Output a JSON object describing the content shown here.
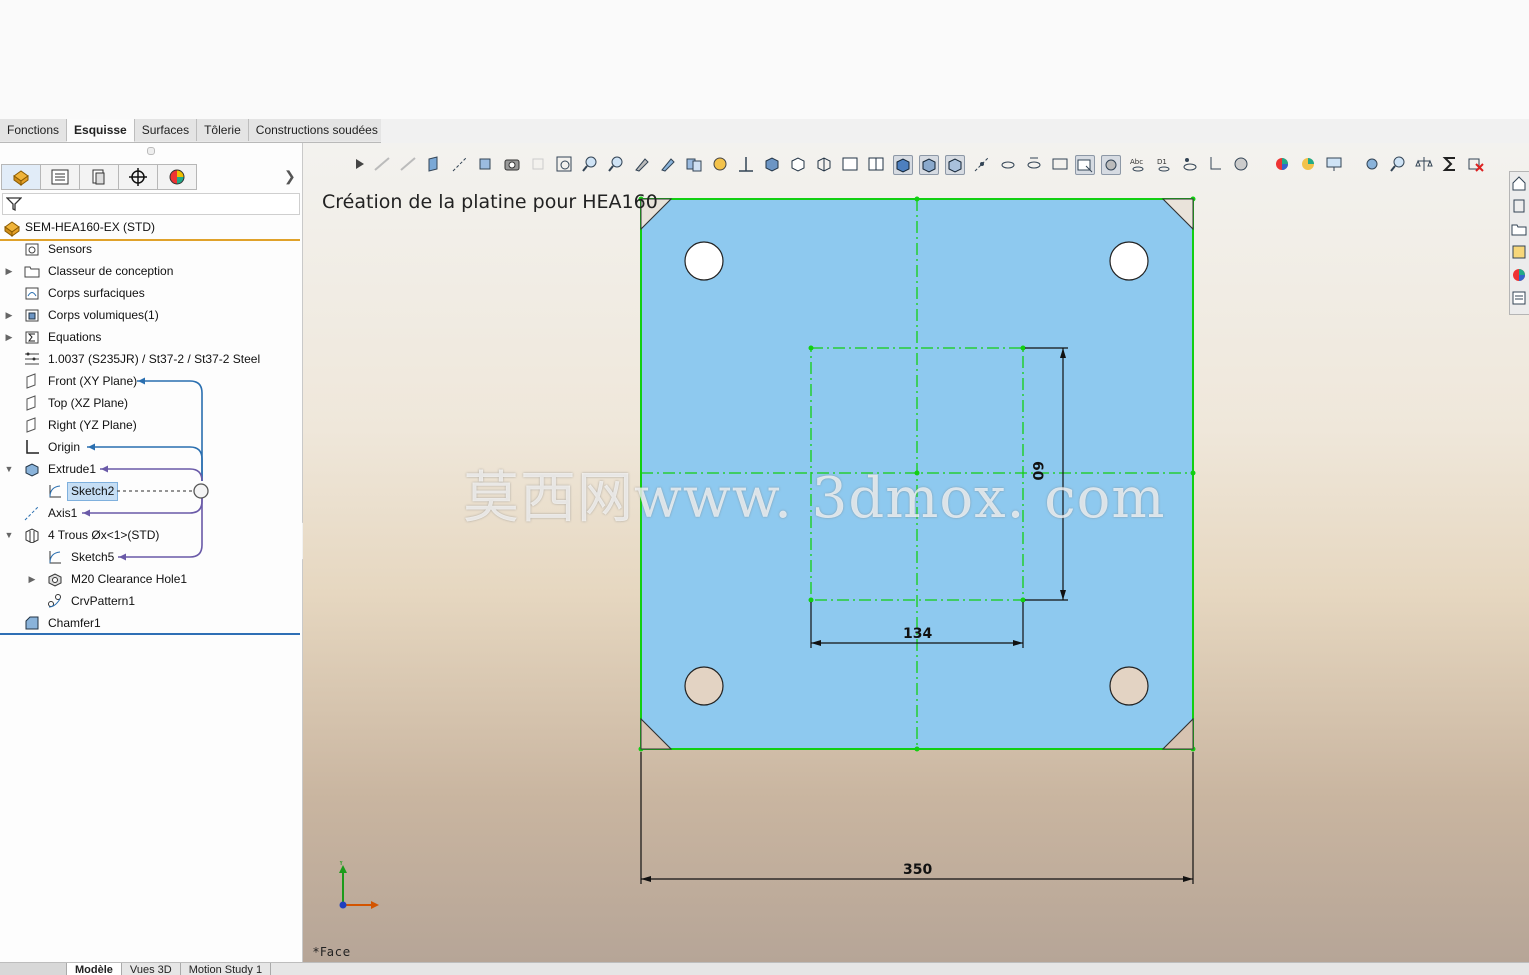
{
  "command_tabs": [
    "Fonctions",
    "Esquisse",
    "Surfaces",
    "Tôlerie",
    "Constructions soudées"
  ],
  "active_command_tab": "Esquisse",
  "panel_tabs": [
    "feature-manager-icon",
    "property-manager-icon",
    "configuration-manager-icon",
    "dimxpert-icon",
    "display-manager-icon"
  ],
  "tree": {
    "root": "SEM-HEA160-EX  (STD)",
    "items": [
      {
        "label": "Sensors",
        "icon": "sensors-icon"
      },
      {
        "label": "Classeur de conception",
        "icon": "folder-icon",
        "expandable": true
      },
      {
        "label": "Corps surfaciques",
        "icon": "surface-bodies-icon"
      },
      {
        "label": "Corps volumiques(1)",
        "icon": "solid-bodies-icon",
        "expandable": true
      },
      {
        "label": "Equations",
        "icon": "equations-icon",
        "expandable": true
      },
      {
        "label": "1.0037 (S235JR) / St37-2 / St37-2 Steel",
        "icon": "material-icon"
      },
      {
        "label": "Front (XY Plane)",
        "icon": "plane-icon"
      },
      {
        "label": "Top (XZ Plane)",
        "icon": "plane-icon"
      },
      {
        "label": "Right (YZ Plane)",
        "icon": "plane-icon"
      },
      {
        "label": "Origin",
        "icon": "origin-icon"
      },
      {
        "label": "Extrude1",
        "icon": "extrude-icon",
        "expanded": true
      },
      {
        "label": "Sketch2",
        "icon": "sketch-icon",
        "selected": true
      },
      {
        "label": "Axis1",
        "icon": "axis-icon"
      },
      {
        "label": "4 Trous Øx<1>(STD)",
        "icon": "part-icon",
        "expanded": true
      },
      {
        "label": "Sketch5",
        "icon": "sketch-icon"
      },
      {
        "label": "M20 Clearance Hole1",
        "icon": "hole-icon",
        "expandable": true
      },
      {
        "label": "CrvPattern1",
        "icon": "pattern-icon"
      },
      {
        "label": "Chamfer1",
        "icon": "chamfer-icon"
      }
    ]
  },
  "viewport": {
    "title": "Création de la platine pour HEA160",
    "status": "*Face",
    "watermark": "莫西网www. 3dmox. com",
    "dimensions": {
      "width": "350",
      "inner_width": "134",
      "inner_height": "60"
    }
  },
  "bottom_tabs": [
    "Modèle",
    "Vues 3D",
    "Motion Study 1"
  ],
  "active_bottom_tab": "Modèle",
  "colors": {
    "plate": "#8ec9ef",
    "sketch": "#00d000",
    "accent": "#e0a22a",
    "selection": "#c6def4"
  }
}
